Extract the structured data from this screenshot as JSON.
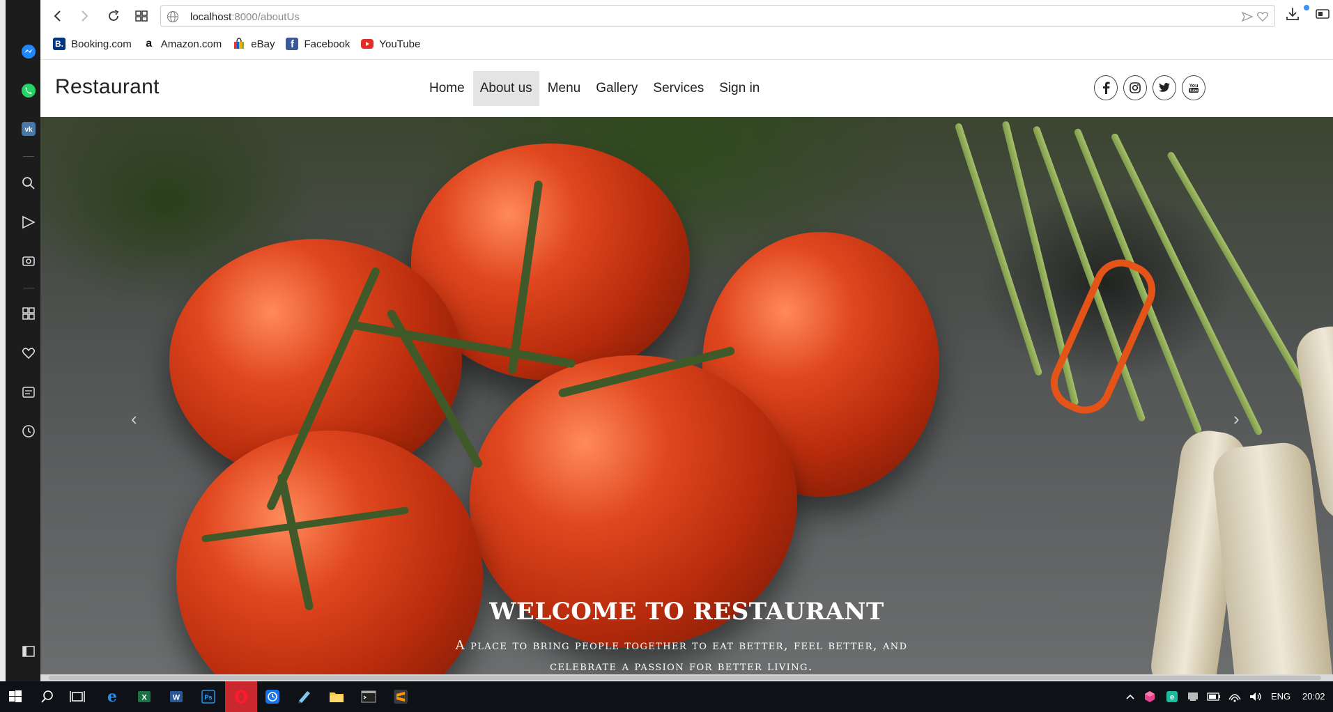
{
  "sidebar": {
    "icons": [
      "messenger-icon",
      "whatsapp-icon",
      "vk-icon",
      "search-icon",
      "send-icon",
      "camera-icon",
      "apps-icon",
      "heart-icon",
      "news-icon",
      "history-icon",
      "sidebar-toggle-icon"
    ]
  },
  "browser": {
    "url_host": "localhost",
    "url_path": ":8000/aboutUs",
    "bookmarks": [
      {
        "label": "Booking.com",
        "icon": "booking-icon",
        "color": "#003580"
      },
      {
        "label": "Amazon.com",
        "icon": "amazon-icon",
        "color": "#ffffff"
      },
      {
        "label": "eBay",
        "icon": "ebay-icon",
        "color": "#ffffff"
      },
      {
        "label": "Facebook",
        "icon": "facebook-icon",
        "color": "#3b5998"
      },
      {
        "label": "YouTube",
        "icon": "youtube-icon",
        "color": "#e52d27"
      }
    ]
  },
  "site": {
    "logo": "Restaurant",
    "menu": [
      {
        "label": "Home",
        "active": false
      },
      {
        "label": "About us",
        "active": true
      },
      {
        "label": "Menu",
        "active": false
      },
      {
        "label": "Gallery",
        "active": false
      },
      {
        "label": "Services",
        "active": false
      },
      {
        "label": "Sign in",
        "active": false
      }
    ],
    "socials": [
      "facebook-icon",
      "instagram-icon",
      "twitter-icon",
      "youtube-icon"
    ],
    "hero": {
      "title": "WELCOME TO RESTAURANT",
      "subtitle": "A place to bring people together to eat better, feel better, and celebrate a passion for better living.",
      "prev": "‹",
      "next": "›"
    }
  },
  "taskbar": {
    "language": "ENG",
    "time": "20:02"
  },
  "colors": {
    "active_menu_bg": "#e4e4e4",
    "sidebar_bg": "#1c1c1c",
    "taskbar_bg": "#0e1116"
  }
}
